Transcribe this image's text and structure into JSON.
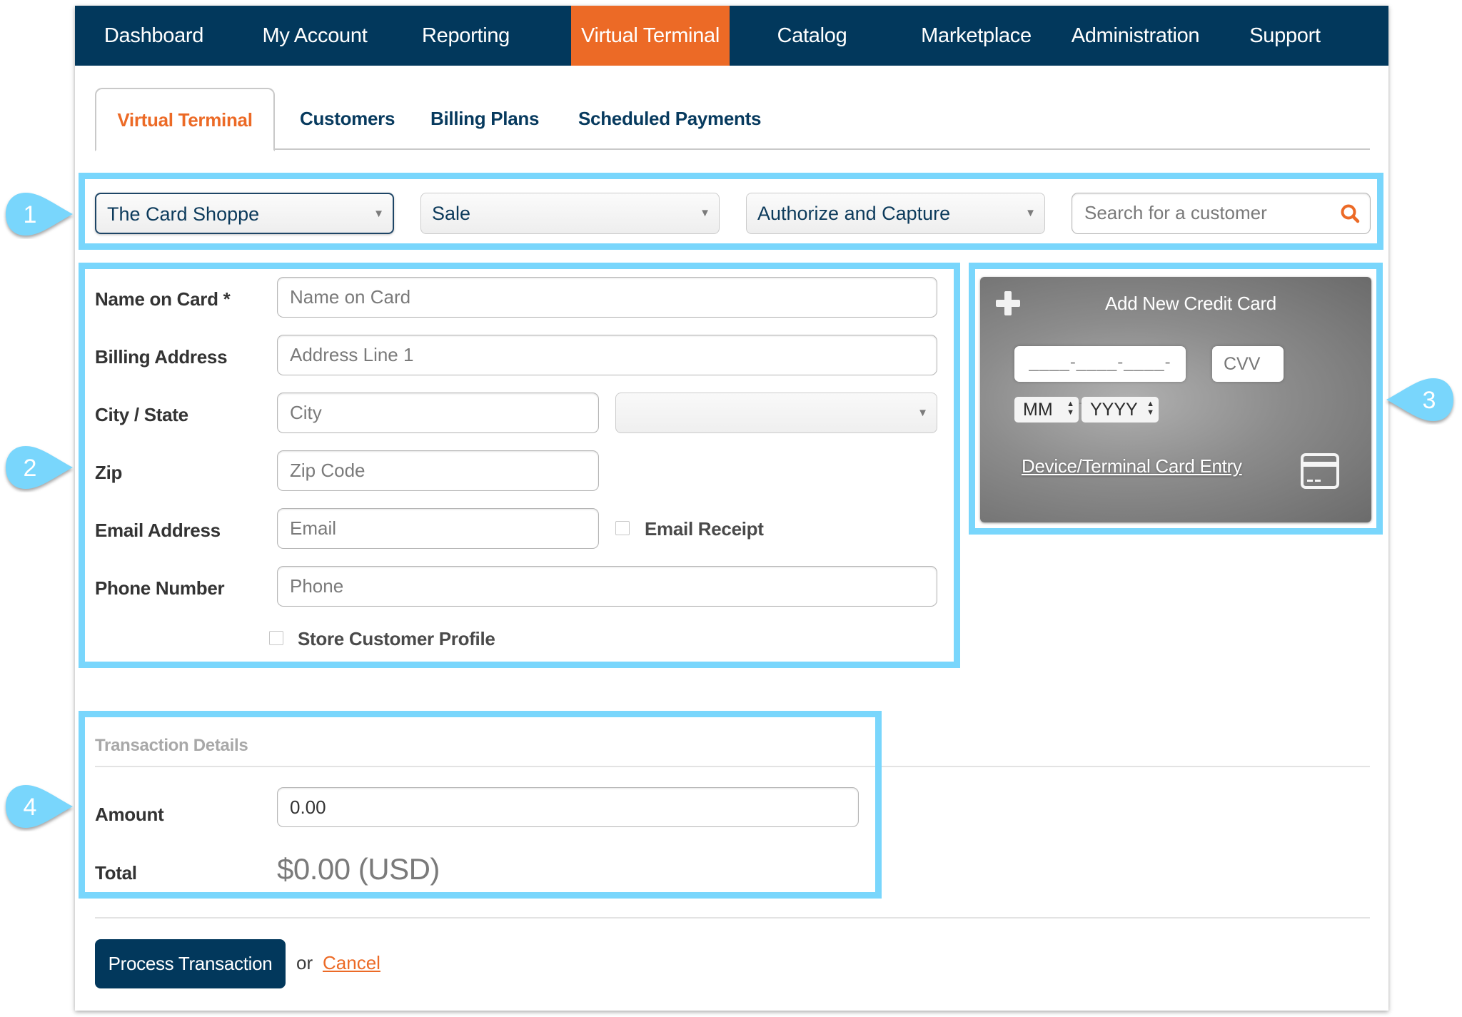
{
  "topnav": {
    "items": [
      {
        "label": "Dashboard",
        "active": false
      },
      {
        "label": "My Account",
        "active": false
      },
      {
        "label": "Reporting",
        "active": false
      },
      {
        "label": "Virtual Terminal",
        "active": true
      },
      {
        "label": "Catalog",
        "active": false
      },
      {
        "label": "Marketplace",
        "active": false
      },
      {
        "label": "Administration",
        "active": false
      },
      {
        "label": "Support",
        "active": false
      }
    ]
  },
  "subtabs": {
    "items": [
      {
        "label": "Virtual Terminal",
        "active": true
      },
      {
        "label": "Customers",
        "active": false
      },
      {
        "label": "Billing Plans",
        "active": false
      },
      {
        "label": "Scheduled Payments",
        "active": false
      }
    ]
  },
  "toolbar": {
    "merchant_select": "The Card Shoppe",
    "transaction_type_select": "Sale",
    "processing_select": "Authorize and Capture",
    "customer_search_placeholder": "Search for a customer",
    "search_icon": "search-icon"
  },
  "customer_form": {
    "name_label": "Name on Card *",
    "name_placeholder": "Name on Card",
    "address_label": "Billing Address",
    "address_placeholder": "Address Line 1",
    "city_state_label": "City / State",
    "city_placeholder": "City",
    "state_select": "",
    "zip_label": "Zip",
    "zip_placeholder": "Zip Code",
    "email_label": "Email Address",
    "email_placeholder": "Email",
    "email_receipt_label": "Email Receipt",
    "email_receipt_checked": false,
    "phone_label": "Phone Number",
    "phone_placeholder": "Phone",
    "store_profile_label": "Store Customer Profile",
    "store_profile_checked": false
  },
  "card_widget": {
    "title": "Add New Credit Card",
    "add_icon": "plus-icon",
    "card_number_placeholder": "____-____-____-____",
    "cvv_placeholder": "CVV",
    "month_select": "MM",
    "year_select": "YYYY",
    "device_entry_link": "Device/Terminal Card Entry",
    "device_icon": "credit-card-icon"
  },
  "transaction": {
    "section_title": "Transaction Details",
    "amount_label": "Amount",
    "amount_value": "0.00",
    "total_label": "Total",
    "total_value": "$0.00 (USD)"
  },
  "actions": {
    "process_label": "Process Transaction",
    "or_text": "or",
    "cancel_label": "Cancel"
  },
  "callouts": [
    "1",
    "2",
    "3",
    "4"
  ],
  "colors": {
    "nav_bg": "#02385c",
    "accent_orange": "#ec6a26",
    "highlight_blue": "#79d6fc"
  }
}
